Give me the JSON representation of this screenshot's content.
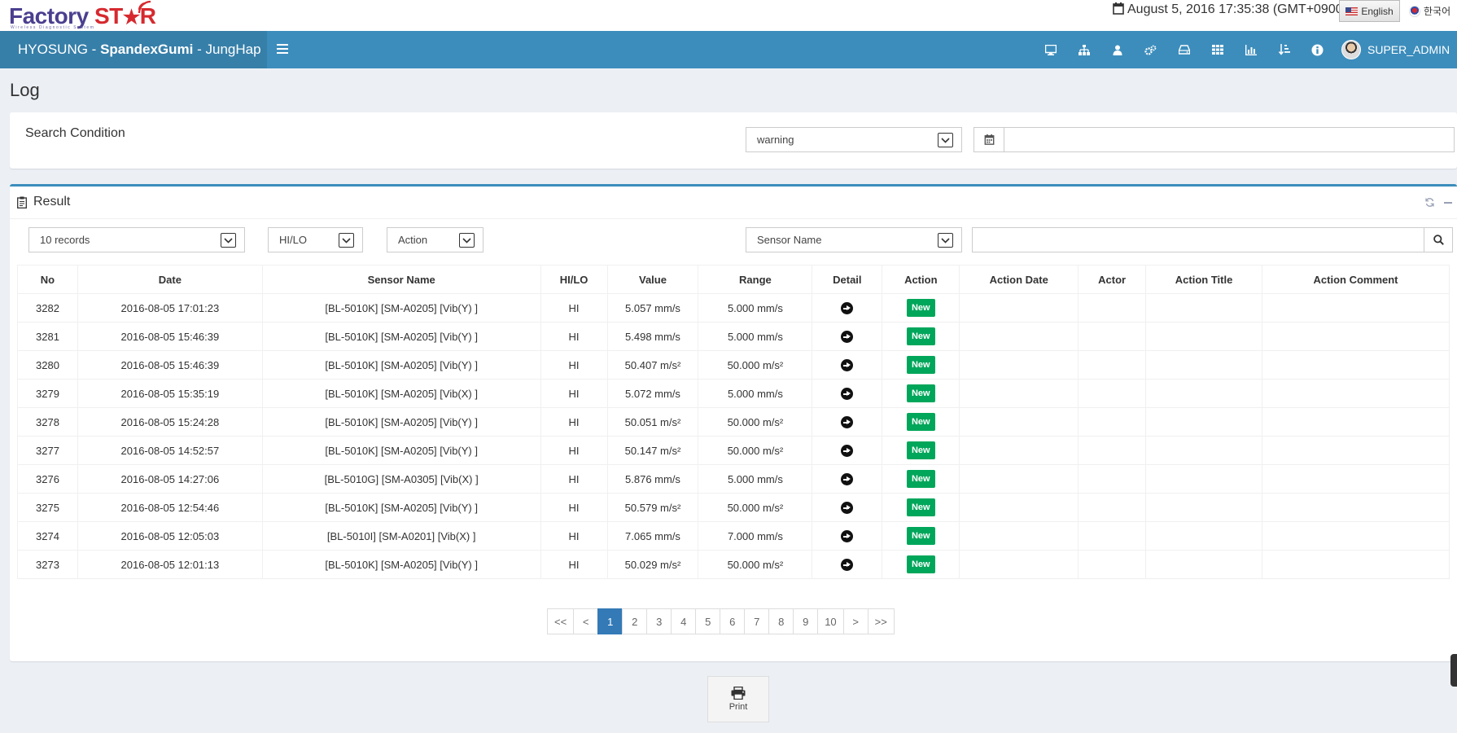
{
  "header": {
    "logo_part1": "Factory ",
    "logo_part2": "ST",
    "logo_part3": "R",
    "logo_subtitle": "Wireless Diagnostic System",
    "datetime": "August 5, 2016 17:35:38 (GMT+0900)",
    "lang_en": "English",
    "lang_ko": "한국어"
  },
  "navbar": {
    "brand_prefix": "HYOSUNG - ",
    "brand_bold": "SpandexGumi",
    "brand_suffix": " - JungHap",
    "user": "SUPER_ADMIN",
    "icons": [
      "monitor-icon",
      "sitemap-icon",
      "user-icon",
      "gears-icon",
      "hdd-icon",
      "grid-icon",
      "bar-chart-icon",
      "sort-icon",
      "info-icon"
    ]
  },
  "page": {
    "title": "Log"
  },
  "search": {
    "label": "Search Condition",
    "type_value": "warning",
    "date_value": ""
  },
  "result": {
    "title": "Result",
    "records_value": "10 records",
    "hilo_value": "HI/LO",
    "action_value": "Action",
    "sensor_filter_value": "Sensor Name",
    "filter_text": ""
  },
  "table": {
    "columns": [
      "No",
      "Date",
      "Sensor Name",
      "HI/LO",
      "Value",
      "Range",
      "Detail",
      "Action",
      "Action Date",
      "Actor",
      "Action Title",
      "Action Comment"
    ],
    "rows": [
      {
        "no": "3282",
        "date": "2016-08-05 17:01:23",
        "sensor": "[BL-5010K] [SM-A0205] [Vib(Y) ]",
        "hilo": "HI",
        "value": "5.057 mm/s",
        "range": "5.000 mm/s",
        "action": "New",
        "action_date": "",
        "actor": "",
        "action_title": "",
        "action_comment": ""
      },
      {
        "no": "3281",
        "date": "2016-08-05 15:46:39",
        "sensor": "[BL-5010K] [SM-A0205] [Vib(Y) ]",
        "hilo": "HI",
        "value": "5.498 mm/s",
        "range": "5.000 mm/s",
        "action": "New",
        "action_date": "",
        "actor": "",
        "action_title": "",
        "action_comment": ""
      },
      {
        "no": "3280",
        "date": "2016-08-05 15:46:39",
        "sensor": "[BL-5010K] [SM-A0205] [Vib(Y) ]",
        "hilo": "HI",
        "value": "50.407 m/s²",
        "range": "50.000 m/s²",
        "action": "New",
        "action_date": "",
        "actor": "",
        "action_title": "",
        "action_comment": ""
      },
      {
        "no": "3279",
        "date": "2016-08-05 15:35:19",
        "sensor": "[BL-5010K] [SM-A0205] [Vib(X) ]",
        "hilo": "HI",
        "value": "5.072 mm/s",
        "range": "5.000 mm/s",
        "action": "New",
        "action_date": "",
        "actor": "",
        "action_title": "",
        "action_comment": ""
      },
      {
        "no": "3278",
        "date": "2016-08-05 15:24:28",
        "sensor": "[BL-5010K] [SM-A0205] [Vib(Y) ]",
        "hilo": "HI",
        "value": "50.051 m/s²",
        "range": "50.000 m/s²",
        "action": "New",
        "action_date": "",
        "actor": "",
        "action_title": "",
        "action_comment": ""
      },
      {
        "no": "3277",
        "date": "2016-08-05 14:52:57",
        "sensor": "[BL-5010K] [SM-A0205] [Vib(Y) ]",
        "hilo": "HI",
        "value": "50.147 m/s²",
        "range": "50.000 m/s²",
        "action": "New",
        "action_date": "",
        "actor": "",
        "action_title": "",
        "action_comment": ""
      },
      {
        "no": "3276",
        "date": "2016-08-05 14:27:06",
        "sensor": "[BL-5010G] [SM-A0305] [Vib(X) ]",
        "hilo": "HI",
        "value": "5.876 mm/s",
        "range": "5.000 mm/s",
        "action": "New",
        "action_date": "",
        "actor": "",
        "action_title": "",
        "action_comment": ""
      },
      {
        "no": "3275",
        "date": "2016-08-05 12:54:46",
        "sensor": "[BL-5010K] [SM-A0205] [Vib(Y) ]",
        "hilo": "HI",
        "value": "50.579 m/s²",
        "range": "50.000 m/s²",
        "action": "New",
        "action_date": "",
        "actor": "",
        "action_title": "",
        "action_comment": ""
      },
      {
        "no": "3274",
        "date": "2016-08-05 12:05:03",
        "sensor": "[BL-5010I] [SM-A0201] [Vib(X) ]",
        "hilo": "HI",
        "value": "7.065 mm/s",
        "range": "7.000 mm/s",
        "action": "New",
        "action_date": "",
        "actor": "",
        "action_title": "",
        "action_comment": ""
      },
      {
        "no": "3273",
        "date": "2016-08-05 12:01:13",
        "sensor": "[BL-5010K] [SM-A0205] [Vib(Y) ]",
        "hilo": "HI",
        "value": "50.029 m/s²",
        "range": "50.000 m/s²",
        "action": "New",
        "action_date": "",
        "actor": "",
        "action_title": "",
        "action_comment": ""
      }
    ]
  },
  "pagination": {
    "items": [
      "<<",
      "<",
      "1",
      "2",
      "3",
      "4",
      "5",
      "6",
      "7",
      "8",
      "9",
      "10",
      ">",
      ">>"
    ],
    "active": "1"
  },
  "footer": {
    "print_label": "Print"
  },
  "colors": {
    "navbar": "#3c8dbc",
    "brand": "#367fa9",
    "badge_new": "#00a65a",
    "page_active": "#337ab7"
  }
}
